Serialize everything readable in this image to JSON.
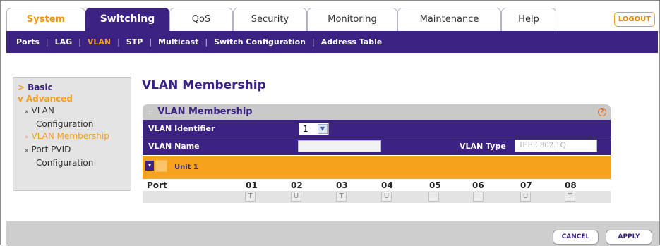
{
  "tabs": [
    {
      "label": "System"
    },
    {
      "label": "Switching"
    },
    {
      "label": "QoS"
    },
    {
      "label": "Security"
    },
    {
      "label": "Monitoring"
    },
    {
      "label": "Maintenance"
    },
    {
      "label": "Help"
    }
  ],
  "logout_label": "LOGOUT",
  "subnav": [
    "Ports",
    "LAG",
    "VLAN",
    "STP",
    "Multicast",
    "Switch Configuration",
    "Address Table"
  ],
  "sidebar": {
    "basic": "Basic",
    "advanced": "Advanced",
    "basic_marker": ">",
    "advanced_marker": "v",
    "items": [
      {
        "line1": "VLAN",
        "line2": "Configuration"
      },
      {
        "line1": "VLAN Membership"
      },
      {
        "line1": "Port PVID",
        "line2": "Configuration"
      }
    ]
  },
  "page_title": "VLAN Membership",
  "panel": {
    "title": "VLAN Membership",
    "help": "?",
    "vlan_identifier_label": "VLAN Identifier",
    "vlan_identifier_value": "1",
    "vlan_name_label": "VLAN Name",
    "vlan_name_value": "",
    "vlan_type_label": "VLAN Type",
    "vlan_type_value": "IEEE 802.1Q",
    "unit_label": "Unit 1",
    "port_label": "Port",
    "ports": [
      {
        "num": "01",
        "state": "T"
      },
      {
        "num": "02",
        "state": "U"
      },
      {
        "num": "03",
        "state": "T"
      },
      {
        "num": "04",
        "state": "U"
      },
      {
        "num": "05",
        "state": ""
      },
      {
        "num": "06",
        "state": ""
      },
      {
        "num": "07",
        "state": "U"
      },
      {
        "num": "08",
        "state": "T"
      }
    ]
  },
  "buttons": {
    "cancel": "CANCEL",
    "apply": "APPLY"
  },
  "colors": {
    "brand_purple": "#3b2283",
    "accent_orange": "#f7a21c"
  }
}
